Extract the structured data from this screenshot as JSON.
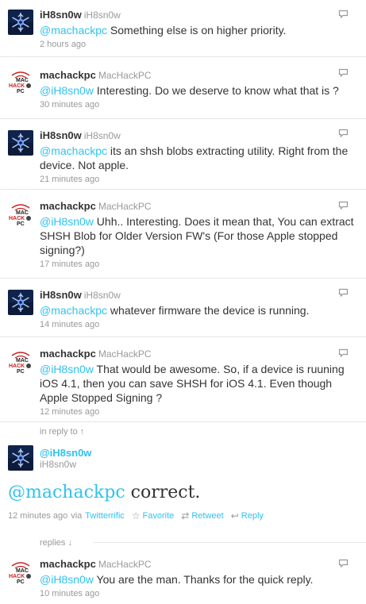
{
  "tweets": [
    {
      "screen_name": "iH8sn0w",
      "full_name": "iH8sn0w",
      "mention": "@machackpc",
      "text": " Something else is on higher priority.",
      "timestamp": "2 hours ago"
    },
    {
      "screen_name": "machackpc",
      "full_name": "MacHackPC",
      "mention": "@iH8sn0w",
      "text": " Interesting. Do we deserve to know what that is ?",
      "timestamp": "30 minutes ago"
    },
    {
      "screen_name": "iH8sn0w",
      "full_name": "iH8sn0w",
      "mention": "@machackpc",
      "text": " its an shsh blobs extracting utility. Right from the device. Not apple.",
      "timestamp": "21 minutes ago"
    },
    {
      "screen_name": "machackpc",
      "full_name": "MacHackPC",
      "mention": "@iH8sn0w",
      "text": " Uhh.. Interesting. Does it mean that, You can extract SHSH Blob for Older Version FW's (For those Apple stopped signing?)",
      "timestamp": "17 minutes ago"
    },
    {
      "screen_name": "iH8sn0w",
      "full_name": "iH8sn0w",
      "mention": "@machackpc",
      "text": " whatever firmware the device is running.",
      "timestamp": "14 minutes ago"
    },
    {
      "screen_name": "machackpc",
      "full_name": "MacHackPC",
      "mention": "@iH8sn0w",
      "text": " That would be awesome. So, if a device is ruuning iOS 4.1, then you can save SHSH for iOS 4.1. Even though Apple Stopped Signing ?",
      "timestamp": "12 minutes ago"
    }
  ],
  "in_reply_to_label": "in reply to ↑",
  "focus": {
    "screen_name": "@iH8sn0w",
    "full_name": "iH8sn0w",
    "mention": "@machackpc",
    "text": " correct.",
    "timestamp": "12 minutes ago",
    "via": "via",
    "source": "Twitterrific",
    "favorite": "Favorite",
    "retweet": "Retweet",
    "reply": "Reply"
  },
  "replies_label": "replies ↓",
  "reply_tweet": {
    "screen_name": "machackpc",
    "full_name": "MacHackPC",
    "mention": "@iH8sn0w",
    "text": " You are the man. Thanks for the quick reply.",
    "timestamp": "10 minutes ago"
  },
  "colors": {
    "link": "#2fc2ef",
    "muted": "#999999",
    "text": "#333333"
  }
}
